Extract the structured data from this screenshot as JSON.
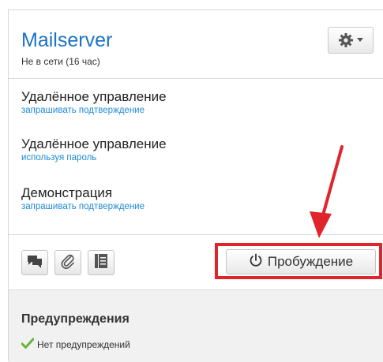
{
  "header": {
    "title": "Mailserver",
    "status": "Не в сети (16 час)",
    "settings_icon": "gear-icon",
    "dropdown_icon": "caret-down-icon"
  },
  "actions": [
    {
      "title": "Удалённое управление",
      "subtitle": "запрашивать подтверждение"
    },
    {
      "title": "Удалённое управление",
      "subtitle": "используя пароль"
    },
    {
      "title": "Демонстрация",
      "subtitle": "запрашивать подтверждение"
    }
  ],
  "toolbar": {
    "icons": [
      "chat-icon",
      "paperclip-icon",
      "document-list-icon"
    ],
    "wake_icon": "power-icon",
    "wake_label": "Пробуждение"
  },
  "warnings": {
    "title": "Предупреждения",
    "none_text": "Нет предупреждений",
    "status_icon": "checkmark-icon"
  },
  "colors": {
    "title": "#1b73c9",
    "link": "#1f8ad6",
    "highlight": "#e0242b",
    "check": "#6ab23a"
  }
}
